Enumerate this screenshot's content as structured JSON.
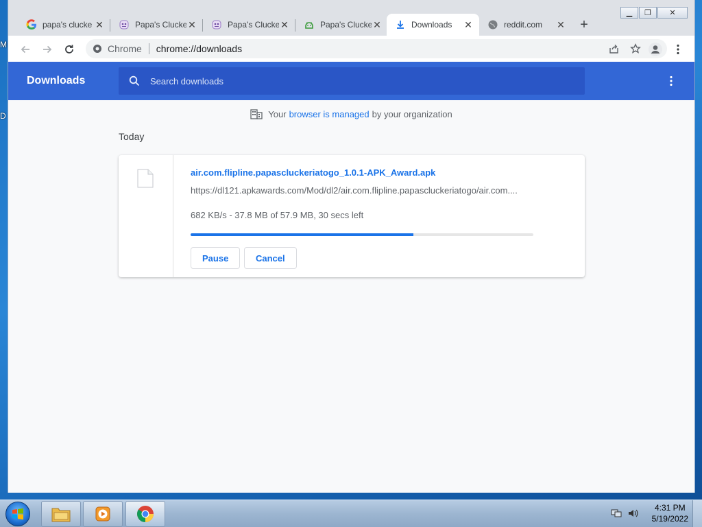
{
  "desktop": {
    "fragment_top": "M",
    "fragment_mid": "D"
  },
  "tabs": [
    {
      "title": "papa's clucke",
      "icon": "google-icon"
    },
    {
      "title": "Papa's Clucke",
      "icon": "game-icon"
    },
    {
      "title": "Papa's Clucke",
      "icon": "game-icon"
    },
    {
      "title": "Papa's Clucke",
      "icon": "android-icon"
    },
    {
      "title": "Downloads",
      "icon": "download-icon"
    },
    {
      "title": "reddit.com",
      "icon": "globe-icon"
    }
  ],
  "omnibox": {
    "site": "Chrome",
    "url": "chrome://downloads"
  },
  "downloads": {
    "title": "Downloads",
    "search_placeholder": "Search downloads",
    "managed": {
      "prefix": "Your",
      "link": "browser is managed",
      "suffix": "by your organization"
    },
    "section": "Today",
    "item": {
      "filename": "air.com.flipline.papascluckeriatogo_1.0.1-APK_Award.apk",
      "url": "https://dl121.apkawards.com/Mod/dl2/air.com.flipline.papascluckeriatogo/air.com....",
      "status": "682 KB/s - 37.8 MB of 57.9 MB, 30 secs left",
      "progress": 0.65,
      "pause_label": "Pause",
      "cancel_label": "Cancel"
    }
  },
  "colors": {
    "header": "#3367d6",
    "search": "#2a56c6",
    "link": "#1a73e8"
  },
  "taskbar": {
    "time": "4:31 PM",
    "date": "5/19/2022"
  }
}
